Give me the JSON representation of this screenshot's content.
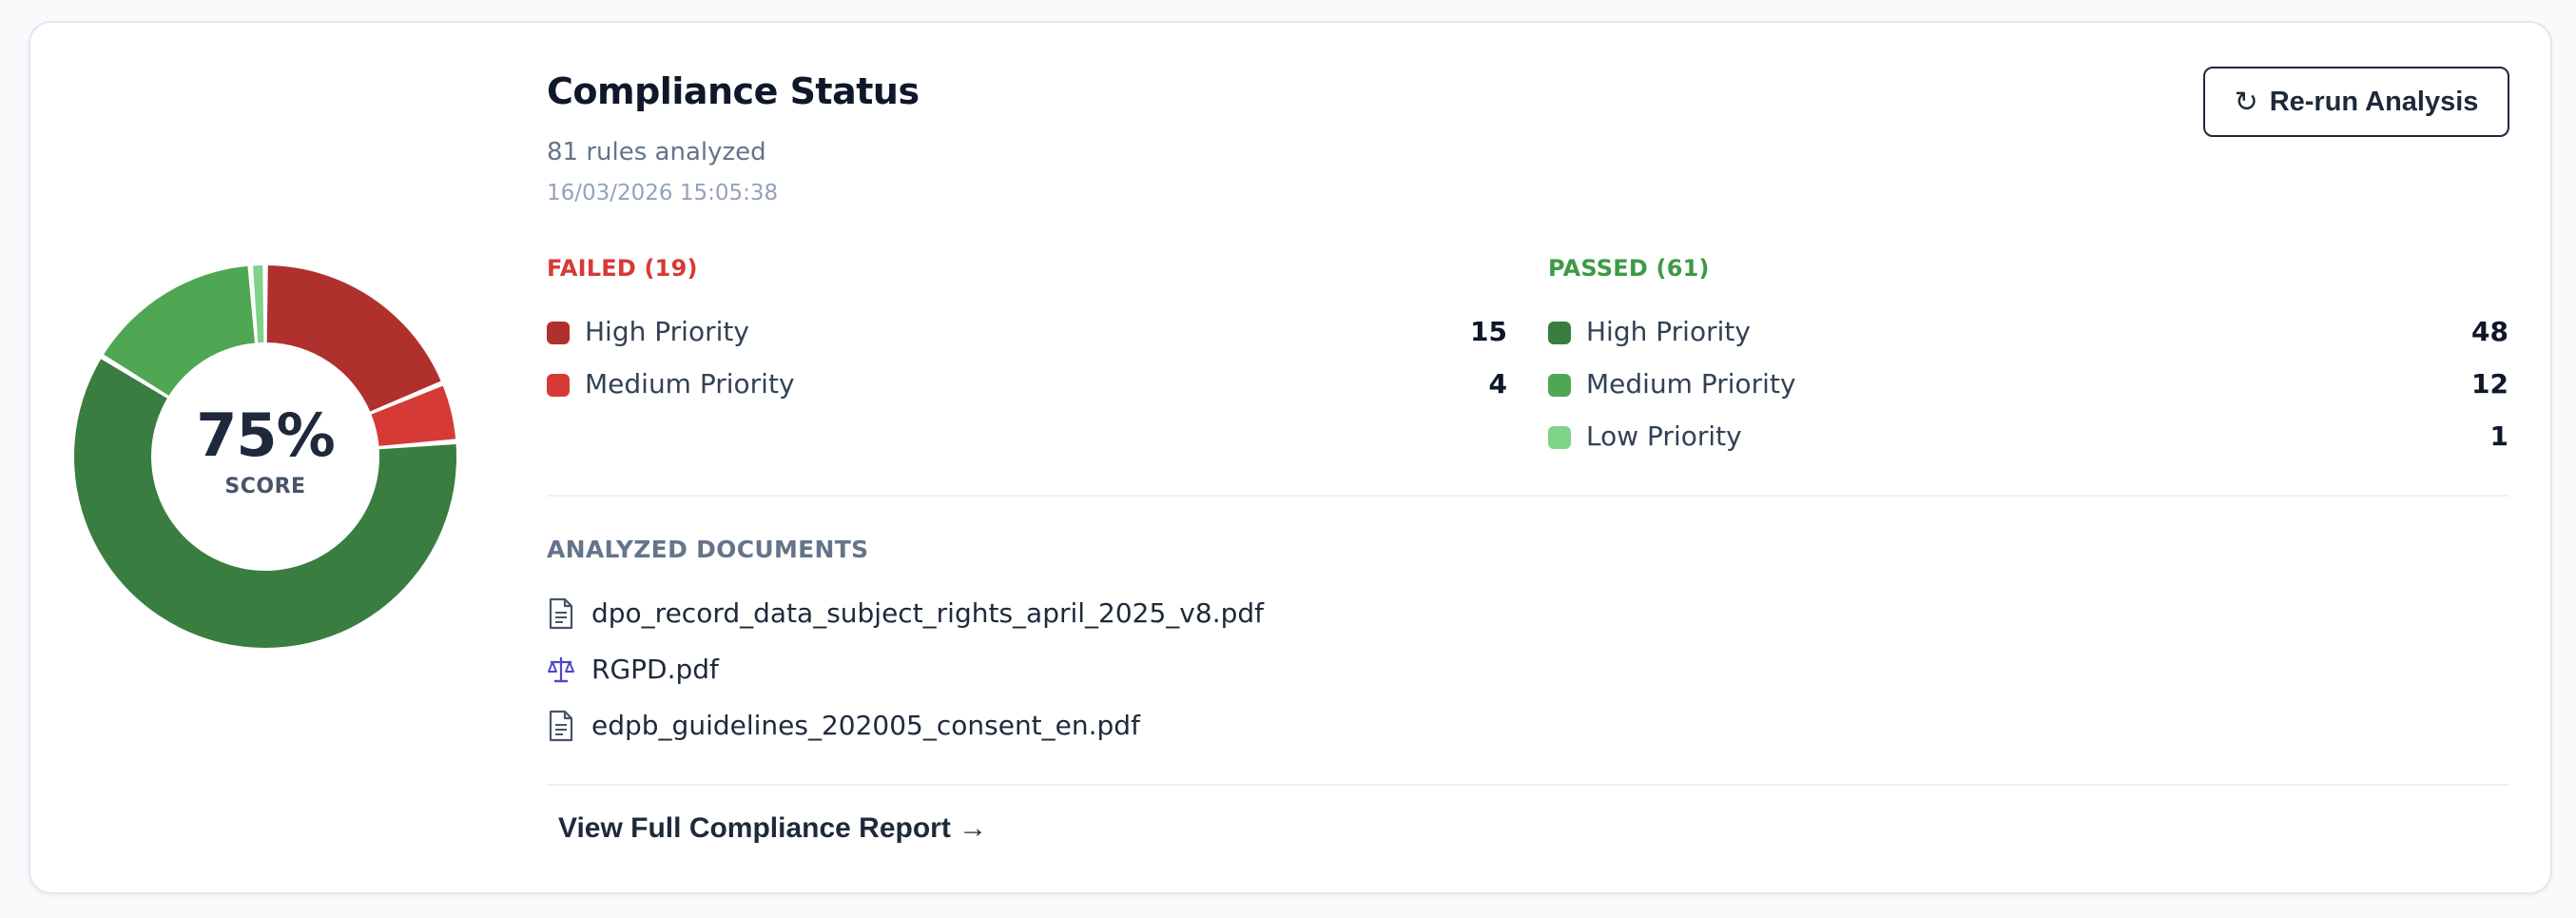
{
  "score": {
    "value": "75%",
    "label": "SCORE"
  },
  "header": {
    "title": "Compliance Status",
    "rules_analyzed": "81 rules analyzed",
    "timestamp": "16/03/2026 15:05:38",
    "rerun_icon": "↻",
    "rerun_label": "Re-run Analysis"
  },
  "failed": {
    "label": "FAILED (19)",
    "items": [
      {
        "label": "High Priority",
        "count": "15",
        "color": "#b0302e"
      },
      {
        "label": "Medium Priority",
        "count": "4",
        "color": "#d63a36"
      }
    ]
  },
  "passed": {
    "label": "PASSED (61)",
    "items": [
      {
        "label": "High Priority",
        "count": "48",
        "color": "#3a7d40"
      },
      {
        "label": "Medium Priority",
        "count": "12",
        "color": "#4fa653"
      },
      {
        "label": "Low Priority",
        "count": "1",
        "color": "#7ed389"
      }
    ]
  },
  "documents": {
    "label": "ANALYZED DOCUMENTS",
    "items": [
      {
        "name": "dpo_record_data_subject_rights_april_2025_v8.pdf",
        "icon": "document-icon"
      },
      {
        "name": "RGPD.pdf",
        "icon": "scales-icon"
      },
      {
        "name": "edpb_guidelines_202005_consent_en.pdf",
        "icon": "document-icon"
      }
    ]
  },
  "report_link": "View Full Compliance Report →",
  "colors": {
    "accent_dark": "#1e293b",
    "failed": "#d63a36",
    "passed": "#3d9a47",
    "scales_icon": "#4f46c8"
  }
}
